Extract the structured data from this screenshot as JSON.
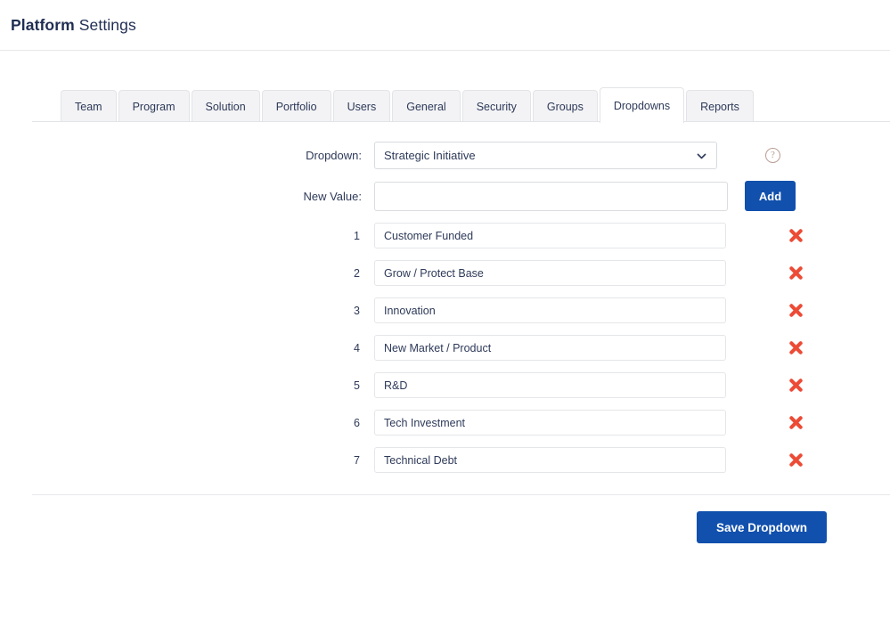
{
  "header": {
    "title_strong": "Platform",
    "title_light": "Settings"
  },
  "tabs": [
    {
      "label": "Team",
      "active": false
    },
    {
      "label": "Program",
      "active": false
    },
    {
      "label": "Solution",
      "active": false
    },
    {
      "label": "Portfolio",
      "active": false
    },
    {
      "label": "Users",
      "active": false
    },
    {
      "label": "General",
      "active": false
    },
    {
      "label": "Security",
      "active": false
    },
    {
      "label": "Groups",
      "active": false
    },
    {
      "label": "Dropdowns",
      "active": true
    },
    {
      "label": "Reports",
      "active": false
    }
  ],
  "form": {
    "dropdown_label": "Dropdown:",
    "dropdown_selected": "Strategic Initiative",
    "dropdown_options": [
      "Strategic Initiative"
    ],
    "new_value_label": "New Value:",
    "new_value": "",
    "new_value_placeholder": "",
    "add_button": "Add",
    "help_glyph": "?"
  },
  "items": [
    {
      "num": "1",
      "value": "Customer Funded"
    },
    {
      "num": "2",
      "value": "Grow / Protect Base"
    },
    {
      "num": "3",
      "value": "Innovation"
    },
    {
      "num": "4",
      "value": "New Market / Product"
    },
    {
      "num": "5",
      "value": "R&D"
    },
    {
      "num": "6",
      "value": "Tech Investment"
    },
    {
      "num": "7",
      "value": "Technical Debt"
    }
  ],
  "footer": {
    "save_button": "Save Dropdown"
  },
  "colors": {
    "primary_blue": "#1150ad",
    "delete_red": "#ec4b36",
    "text_navy": "#2e3a59",
    "title_navy": "#1f2d52",
    "help_tan": "#b99d93",
    "tab_inactive_bg": "#f3f3f5",
    "border_gray": "#e3e4e7"
  }
}
